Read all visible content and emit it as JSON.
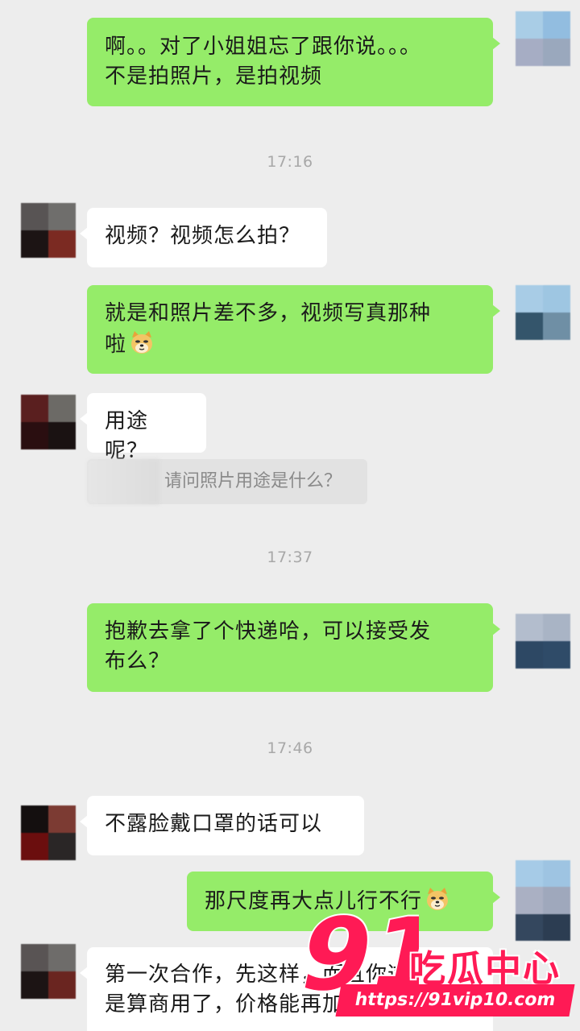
{
  "messages": [
    {
      "side": "out",
      "lines": [
        "啊。。对了小姐姐忘了跟你说。。。",
        "不是拍照片，是拍视频"
      ]
    },
    {
      "timestamp": "17:16"
    },
    {
      "side": "in",
      "lines": [
        "视频？视频怎么拍？"
      ]
    },
    {
      "side": "out",
      "lines": [
        "就是和照片差不多，视频写真那种",
        "啦"
      ],
      "emoji": "doge-emoji"
    },
    {
      "side": "in",
      "lines": [
        "用途呢？"
      ]
    },
    {
      "quote": "请问照片用途是什么？"
    },
    {
      "timestamp": "17:37"
    },
    {
      "side": "out",
      "lines": [
        "抱歉去拿了个快递哈，可以接受发",
        "布么？"
      ]
    },
    {
      "timestamp": "17:46"
    },
    {
      "side": "in",
      "lines": [
        "不露脸戴口罩的话可以"
      ]
    },
    {
      "side": "out",
      "lines": [
        "那尺度再大点儿行不行"
      ],
      "emoji": "doge-emoji"
    },
    {
      "side": "in",
      "lines": [
        "第一次合作，先这样吧，而且你这",
        "是算商用了，价格能再加点？"
      ]
    }
  ],
  "timestamps": {
    "t1": "17:16",
    "t2": "17:37",
    "t3": "17:46"
  },
  "bubbles": {
    "m1_l1": "啊。。对了小姐姐忘了跟你说。。。",
    "m1_l2": "不是拍照片，是拍视频",
    "m2": "视频？视频怎么拍？",
    "m3_l1": "就是和照片差不多，视频写真那种",
    "m3_l2": "啦",
    "m4": "用途呢？",
    "quote": "请问照片用途是什么？",
    "m5_l1": "抱歉去拿了个快递哈，可以接受发",
    "m5_l2": "布么？",
    "m6": "不露脸戴口罩的话可以",
    "m7": "那尺度再大点儿行不行",
    "m8_l1": "第一次合作，先这样",
    "m8_l1b": "，而且你这",
    "m8_l2": "是算商用了，价格能再加点"
  },
  "watermark": {
    "number": "91",
    "title": "吃瓜中心",
    "url": "https://91vip10.com"
  },
  "colors": {
    "background": "#ededed",
    "outgoing_bubble": "#95ec69",
    "incoming_bubble": "#ffffff",
    "timestamp_text": "#a8a8a8",
    "watermark": "#ff1a55"
  }
}
